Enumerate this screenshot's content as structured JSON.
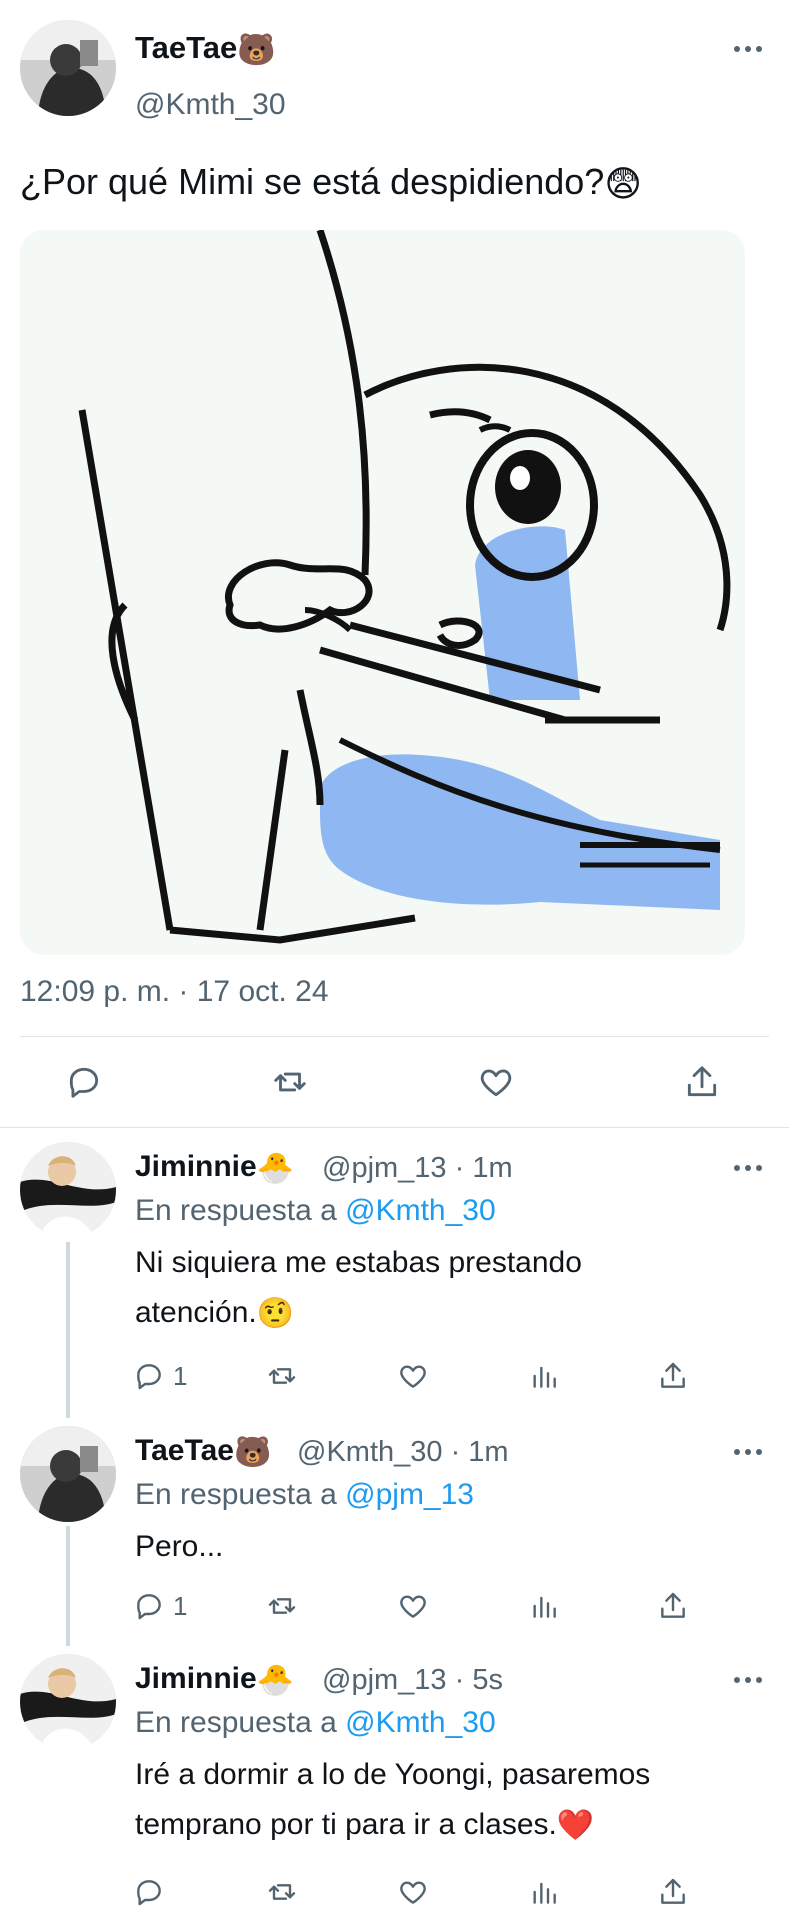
{
  "main_tweet": {
    "display_name": "TaeTae",
    "name_emoji": "🐻",
    "handle": "@Kmth_30",
    "text": "¿Por qué Mimi se está despidiendo?",
    "text_emoji": "😨",
    "timestamp": "12:09 p. m. · 17 oct. 24",
    "actions": [
      "reply-icon",
      "retweet-icon",
      "like-icon",
      "share-icon"
    ]
  },
  "replies": [
    {
      "display_name": "Jiminnie",
      "name_emoji": "🐣",
      "handle_time": "@pjm_13 · 1m",
      "reply_prefix": "En respuesta a",
      "reply_mention": "@Kmth_30",
      "line1": "Ni siquiera me estabas prestando",
      "line2": "atención.",
      "line2_emoji": "🤨",
      "reply_count": "1"
    },
    {
      "display_name": "TaeTae",
      "name_emoji": "🐻",
      "handle_time": "@Kmth_30 · 1m",
      "reply_prefix": "En respuesta a",
      "reply_mention": "@pjm_13",
      "line1": "Pero...",
      "reply_count": "1"
    },
    {
      "display_name": "Jiminnie",
      "name_emoji": "🐣",
      "handle_time": "@pjm_13 · 5s",
      "reply_prefix": "En respuesta a",
      "reply_mention": "@Kmth_30",
      "line1": "Iré a dormir a lo de Yoongi, pasaremos",
      "line2": "temprano por ti para ir a clases.",
      "line2_emoji": "❤️"
    }
  ],
  "colors": {
    "link": "#1d9bf0",
    "secondary": "#536471",
    "text": "#0f1419",
    "divider": "#dfe3e6",
    "meme_blue": "#8fb7f2"
  }
}
